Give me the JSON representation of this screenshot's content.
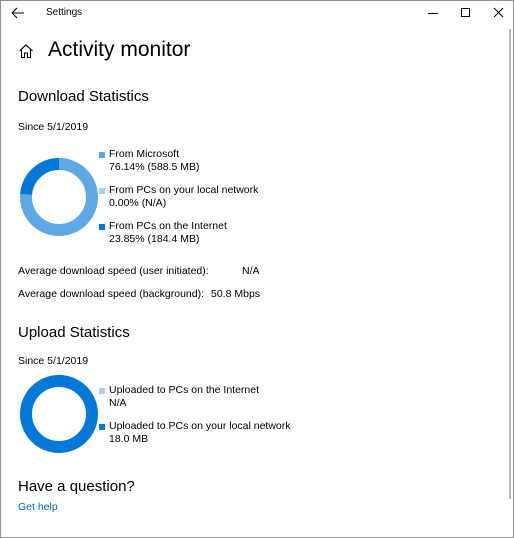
{
  "window": {
    "title": "Settings"
  },
  "page": {
    "title": "Activity monitor"
  },
  "download": {
    "section_title": "Download Statistics",
    "since": "Since 5/1/2019",
    "legend": [
      {
        "label": "From Microsoft",
        "value": "76.14%  (588.5 MB)",
        "percent": 76.14,
        "color": "#5ea8e6"
      },
      {
        "label": "From PCs on your local network",
        "value": "0.00%  (N/A)",
        "percent": 0.0,
        "color": "#a9d0f2"
      },
      {
        "label": "From PCs on the Internet",
        "value": "23.85%  (184.4 MB)",
        "percent": 23.85,
        "color": "#0078d7"
      }
    ],
    "stats": [
      {
        "label": "Average download speed (user initiated):",
        "value": "N/A"
      },
      {
        "label": "Average download speed (background):",
        "value": "50.8 Mbps"
      }
    ]
  },
  "upload": {
    "section_title": "Upload Statistics",
    "since": "Since 5/1/2019",
    "legend": [
      {
        "label": "Uploaded to PCs on the Internet",
        "value": "N/A",
        "percent": 0.0,
        "color": "#a9d0f2"
      },
      {
        "label": "Uploaded to PCs on your local network",
        "value": "18.0 MB",
        "percent": 100.0,
        "color": "#0078d7"
      }
    ]
  },
  "help": {
    "title": "Have a question?",
    "link": "Get help"
  },
  "icons": {
    "back": "back-arrow-icon",
    "minimize": "minimize-icon",
    "maximize": "maximize-icon",
    "close": "close-icon",
    "home": "home-icon"
  },
  "colors": {
    "accent": "#0078d7",
    "link": "#0063b1"
  }
}
